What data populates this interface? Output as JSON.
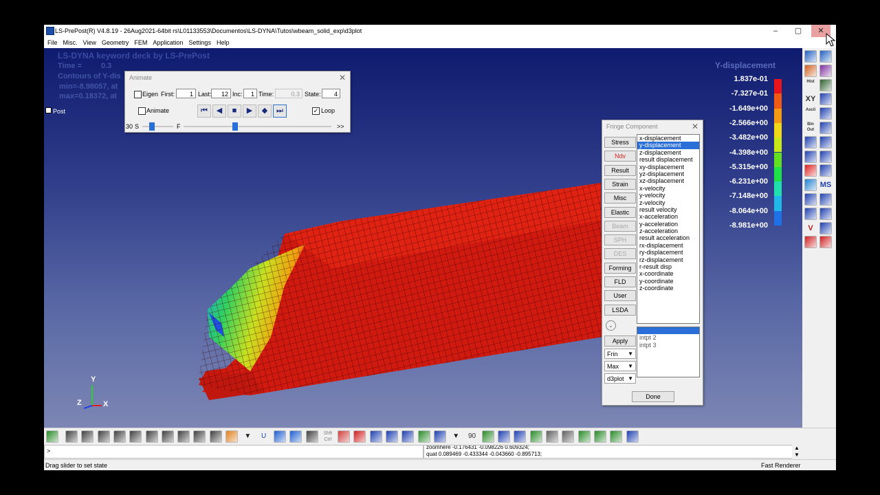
{
  "window": {
    "title": "LS-PrePost(R) V4.8.19 - 26Aug2021-64bit rs\\L01133553\\Documentos\\LS-DYNA\\Tutos\\wbeam_solid_exp\\d3plot",
    "min_icon": "minimize-icon",
    "max_icon": "maximize-icon",
    "close_icon": "close-icon"
  },
  "menu": [
    "File",
    "Misc.",
    "View",
    "Geometry",
    "FEM",
    "Application",
    "Settings",
    "Help"
  ],
  "viewport": {
    "header": "LS-DYNA keyword deck by LS-PrePost",
    "time_label": "Time =",
    "time_value": "0.3",
    "contour_label": "Contours of Y-dis",
    "min_label": "min=-8.98057, at",
    "max_label": "max=0.18372, at",
    "tree_label": "Post",
    "fringe_title": "Y-displacement",
    "axis": {
      "y": "Y",
      "z": "Z",
      "x": "X"
    }
  },
  "fringe_scale": [
    {
      "label": "1.837e-01",
      "color": "#e8141c"
    },
    {
      "label": "-7.327e-01",
      "color": "#f05a12"
    },
    {
      "label": "-1.649e+00",
      "color": "#f39a12"
    },
    {
      "label": "-2.566e+00",
      "color": "#f0d818"
    },
    {
      "label": "-3.482e+00",
      "color": "#c8e818"
    },
    {
      "label": "-4.398e+00",
      "color": "#62e020"
    },
    {
      "label": "-5.315e+00",
      "color": "#20e048"
    },
    {
      "label": "-6.231e+00",
      "color": "#20e0b0"
    },
    {
      "label": "-7.148e+00",
      "color": "#20b8e8"
    },
    {
      "label": "-8.064e+00",
      "color": "#2070e8"
    },
    {
      "label": "-8.981e+00",
      "color": "#1414d8"
    }
  ],
  "animate": {
    "title": "Animate",
    "eigen_label": "Eigen",
    "first_label": "First:",
    "first_value": "1",
    "last_label": "Last:",
    "last_value": "12",
    "inc_label": "Inc:",
    "inc_value": "1",
    "time_label": "Time:",
    "time_value": "0.3",
    "state_label": "State:",
    "state_value": "4",
    "animate_label": "Animate",
    "loop_label": "Loop",
    "loop_checked": "✓",
    "speed_value": "30",
    "s_label": "S",
    "f_label": "F",
    "more_label": ">>",
    "speed_level": 0.3,
    "frame_level": 0.35,
    "buttons": {
      "first": "⏮",
      "back": "◀",
      "stop": "■",
      "play": "▶",
      "bounce": "◆",
      "last": "⏭"
    }
  },
  "fringe_component": {
    "title": "Fringe Component",
    "categories": [
      {
        "label": "Stress",
        "state": "normal"
      },
      {
        "label": "Ndv",
        "state": "active"
      },
      {
        "label": "Result",
        "state": "normal"
      },
      {
        "label": "Strain",
        "state": "normal"
      },
      {
        "label": "Misc",
        "state": "normal"
      },
      {
        "label": "Elastic",
        "state": "normal"
      },
      {
        "label": "Beam",
        "state": "disabled"
      },
      {
        "label": "SPH",
        "state": "disabled"
      },
      {
        "label": "DES",
        "state": "disabled"
      },
      {
        "label": "Forming",
        "state": "normal"
      },
      {
        "label": "FLD",
        "state": "normal"
      },
      {
        "label": "User",
        "state": "normal"
      },
      {
        "label": "LSDA",
        "state": "normal"
      }
    ],
    "components": [
      "x-displacement",
      "y-displacement",
      "z-displacement",
      "result displacement",
      "xy-displacement",
      "yz-displacement",
      "xz-displacement",
      "x-velocity",
      "y-velocity",
      "z-velocity",
      "result velocity",
      "x-acceleration",
      "y-acceleration",
      "z-acceleration",
      "result acceleration",
      "rx-displacement",
      "ry-displacement",
      "rz-displacement",
      "r-result disp",
      "x-coordinate",
      "y-coordinate",
      "z-coordinate"
    ],
    "selected_component": "y-displacement",
    "intpts": [
      "",
      "intpt   2",
      "intpt   3"
    ],
    "apply_label": "Apply",
    "frin_label": "Frin",
    "max_label": "Max",
    "d3plot_label": "d3plot",
    "done_label": "Done"
  },
  "right_toolbar": [
    {
      "icon": "cube-icon",
      "text": "",
      "color": "#2060c0"
    },
    {
      "icon": "model-icon",
      "text": "",
      "color": "#2060c0"
    },
    {
      "icon": "geom-icon",
      "text": "",
      "color": "#d06020"
    },
    {
      "icon": "curve-icon",
      "text": "",
      "color": "#8030a0"
    },
    {
      "icon": "hist-icon",
      "text": "Hist",
      "color": "#303030"
    },
    {
      "icon": "pen-icon",
      "text": "",
      "color": "#306030"
    },
    {
      "icon": "xy-plot-icon",
      "text": "XY",
      "color": "#303030"
    },
    {
      "icon": "sphere-icon",
      "text": "",
      "color": "#2040b0"
    },
    {
      "icon": "ascii-icon",
      "text": "Ascii",
      "color": "#303030"
    },
    {
      "icon": "box-icon",
      "text": "",
      "color": "#2040b0"
    },
    {
      "icon": "binout-icon",
      "text": "Bin Out",
      "color": "#303030"
    },
    {
      "icon": "mesh-icon",
      "text": "",
      "color": "#2040b0"
    },
    {
      "icon": "wave-icon",
      "text": "",
      "color": "#2040b0"
    },
    {
      "icon": "plane-icon",
      "text": "",
      "color": "#2040b0"
    },
    {
      "icon": "spring-icon",
      "text": "",
      "color": "#2040b0"
    },
    {
      "icon": "grid-icon",
      "text": "",
      "color": "#2040b0"
    },
    {
      "icon": "fringe-icon",
      "text": "",
      "color": "#e02020"
    },
    {
      "icon": "table-icon",
      "text": "",
      "color": "#2040b0"
    },
    {
      "icon": "sun-icon",
      "text": "",
      "color": "#2080d0"
    },
    {
      "icon": "ms-icon",
      "text": "MS",
      "color": "#2040b0"
    },
    {
      "icon": "scene-icon",
      "text": "",
      "color": "#2040b0"
    },
    {
      "icon": "check-icon",
      "text": "",
      "color": "#2040b0"
    },
    {
      "icon": "cursor-icon",
      "text": "",
      "color": "#2040b0"
    },
    {
      "icon": "list-icon",
      "text": "",
      "color": "#2040b0"
    },
    {
      "icon": "vector-icon",
      "text": "V",
      "color": "#b02020"
    },
    {
      "icon": "tensor-icon",
      "text": "",
      "color": "#2040b0"
    },
    {
      "icon": "star-icon",
      "text": "",
      "color": "#d02020"
    },
    {
      "icon": "bookmark-icon",
      "text": "",
      "color": "#d02020"
    }
  ],
  "bottom_toolbar": [
    {
      "icon": "home-view-icon",
      "text": "",
      "color": "#2a8a2a"
    },
    {
      "icon": "wire-cube-icon",
      "text": "",
      "color": "#404040"
    },
    {
      "icon": "shade-cube-icon",
      "text": "",
      "color": "#404040"
    },
    {
      "icon": "hidden-cube-icon",
      "text": "",
      "color": "#404040"
    },
    {
      "icon": "feature-cube-icon",
      "text": "",
      "color": "#404040"
    },
    {
      "icon": "edge-cube-icon",
      "text": "",
      "color": "#404040"
    },
    {
      "icon": "line-cube-icon",
      "text": "",
      "color": "#404040"
    },
    {
      "icon": "dots-icon",
      "text": "",
      "color": "#404040"
    },
    {
      "icon": "mesh-cube-icon",
      "text": "",
      "color": "#404040"
    },
    {
      "icon": "solid-cube-icon",
      "text": "",
      "color": "#404040"
    },
    {
      "icon": "cut-cube-icon",
      "text": "",
      "color": "#404040"
    },
    {
      "icon": "fringe-plot-icon",
      "text": "",
      "color": "#e08020"
    },
    {
      "icon": "dropdown-icon",
      "text": "▼",
      "color": "#202020"
    },
    {
      "icon": "u-icon",
      "text": "U",
      "color": "#2040b0"
    },
    {
      "icon": "blue-cube-icon",
      "text": "",
      "color": "#2060d0"
    },
    {
      "icon": "blue-slab-icon",
      "text": "",
      "color": "#2060d0"
    },
    {
      "icon": "outline-cube-icon",
      "text": "",
      "color": "#404040"
    },
    {
      "icon": "shift-ctrl-icon",
      "text": "Shft Ctrl",
      "color": "#808080"
    },
    {
      "icon": "brush-icon",
      "text": "",
      "color": "#d04040"
    },
    {
      "icon": "zoom-box-icon",
      "text": "",
      "color": "#d02020"
    },
    {
      "icon": "zoom-in-icon",
      "text": "",
      "color": "#2040b0"
    },
    {
      "icon": "zoom-area-icon",
      "text": "",
      "color": "#2040b0"
    },
    {
      "icon": "rotate-icon",
      "text": "",
      "color": "#2040b0"
    },
    {
      "icon": "globe-icon",
      "text": "",
      "color": "#2a8a2a"
    },
    {
      "icon": "frame-icon",
      "text": "",
      "color": "#2040b0"
    },
    {
      "icon": "dropdown2-icon",
      "text": "▼",
      "color": "#202020"
    },
    {
      "icon": "angle-icon",
      "text": "90",
      "color": "#303030"
    },
    {
      "icon": "axes-icon",
      "text": "",
      "color": "#2a8a2a"
    },
    {
      "icon": "cube-view-icon",
      "text": "",
      "color": "#2040b0"
    },
    {
      "icon": "house-icon",
      "text": "",
      "color": "#2040b0"
    },
    {
      "icon": "color-grid-icon",
      "text": "",
      "color": "#2a8a2a"
    },
    {
      "icon": "checker-icon",
      "text": "",
      "color": "#606060"
    },
    {
      "icon": "parts-icon",
      "text": "",
      "color": "#606060"
    },
    {
      "icon": "sphere-green-icon",
      "text": "",
      "color": "#2a8a2a"
    },
    {
      "icon": "tools-icon",
      "text": "",
      "color": "#2a8a2a"
    },
    {
      "icon": "flower-icon",
      "text": "",
      "color": "#2a8a2a"
    },
    {
      "icon": "image-icon",
      "text": "",
      "color": "#2040b0"
    }
  ],
  "command": {
    "prompt": ">"
  },
  "log": [
    "zoomhere -0.176431 -0.098226 0.609324;",
    "quat 0.089469 -0.433344 -0.043660 -0.895713;"
  ],
  "status": {
    "message": "Drag slider to set state",
    "renderer": "Fast Renderer"
  }
}
